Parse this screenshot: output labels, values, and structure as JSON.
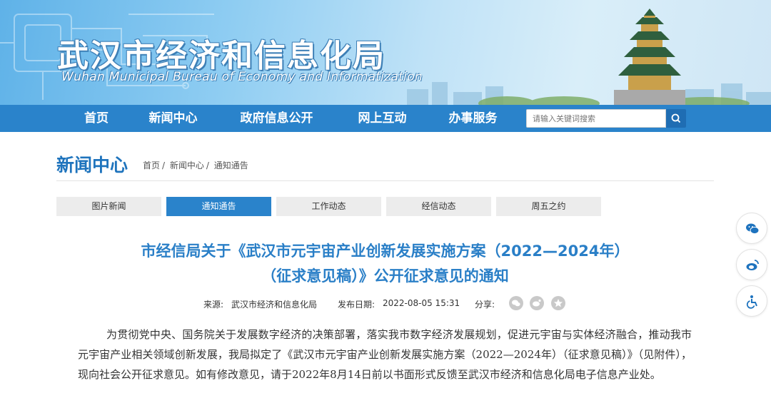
{
  "header": {
    "site_name_cn": "武汉市经济和信息化局",
    "site_name_en": "Wuhan Municipal Bureau of Economy and Informatization"
  },
  "nav": {
    "items": [
      {
        "label": "首页"
      },
      {
        "label": "新闻中心"
      },
      {
        "label": "政府信息公开"
      },
      {
        "label": "网上互动"
      },
      {
        "label": "办事服务"
      }
    ],
    "search_placeholder": "请输入关键词搜索",
    "search_icon": "search-icon"
  },
  "section": {
    "title": "新闻中心",
    "breadcrumb": [
      "首页",
      "/",
      "新闻中心",
      "/",
      "通知通告"
    ]
  },
  "tabs": [
    {
      "label": "图片新闻",
      "active": false
    },
    {
      "label": "通知通告",
      "active": true
    },
    {
      "label": "工作动态",
      "active": false
    },
    {
      "label": "经信动态",
      "active": false
    },
    {
      "label": "周五之约",
      "active": false
    }
  ],
  "article": {
    "title_line1": "市经信局关于《武汉市元宇宙产业创新发展实施方案（2022—2024年）",
    "title_line2": "（征求意见稿）》公开征求意见的通知",
    "source_label": "来源:",
    "source_value": "武汉市经济和信息化局",
    "date_label": "发布日期:",
    "date_value": "2022-08-05 15:31",
    "share_label": "分享:",
    "share_icons": [
      "wechat-icon",
      "weibo-icon",
      "favorite-icon"
    ],
    "body": "为贯彻党中央、国务院关于发展数字经济的决策部署，落实我市数字经济发展规划，促进元宇宙与实体经济融合，推动我市元宇宙产业相关领域创新发展，我局拟定了《武汉市元宇宙产业创新发展实施方案（2022—2024年）（征求意见稿）》（见附件），现向社会公开征求意见。如有修改意见，请于2022年8月14日前以书面形式反馈至武汉市经济和信息化局电子信息产业处。"
  },
  "side_tools": [
    "wechat-icon",
    "weibo-icon",
    "accessibility-icon"
  ],
  "colors": {
    "primary": "#2a83cb",
    "title": "#2a7fc7",
    "section": "#1f74bd"
  }
}
